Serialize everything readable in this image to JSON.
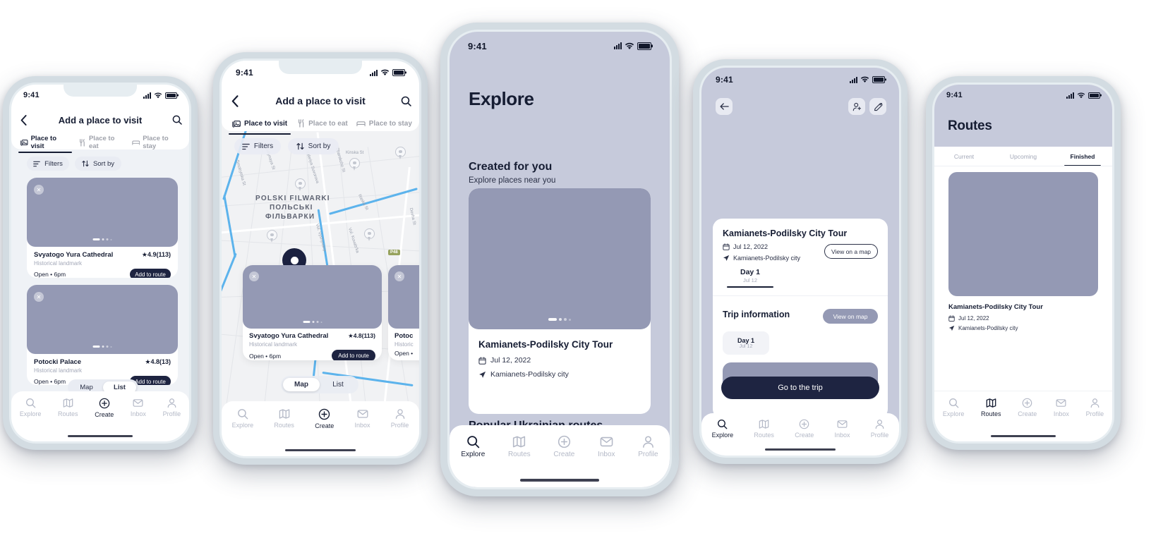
{
  "meta": {
    "status_time": "9:41",
    "colors": {
      "dark": "#1e2441",
      "lavender": "#c6cadb",
      "thumb": "#9499b4",
      "muted": "#a3a8b8",
      "phone_frame": "#d3dce2"
    }
  },
  "screens": {
    "add_place_list": {
      "header_title": "Add a place to visit",
      "back_icon": "chevron-left-icon",
      "search_icon": "search-icon",
      "tabs": [
        {
          "label": "Place to visit",
          "icon": "photo-icon",
          "active": true
        },
        {
          "label": "Place to eat",
          "icon": "cutlery-icon",
          "active": false
        },
        {
          "label": "Place to stay",
          "icon": "bed-icon",
          "active": false
        }
      ],
      "controls": [
        {
          "label": "Filters",
          "icon": "filters-icon"
        },
        {
          "label": "Sort by",
          "icon": "sort-icon"
        }
      ],
      "places": [
        {
          "name": "Svyatogo Yura Cathedral",
          "category": "Historical landmark",
          "hours": "Open • 6pm",
          "rating": "4.9(113)",
          "action": "Add to route"
        },
        {
          "name": "Potocki Palace",
          "category": "Historical landmark",
          "hours": "Open • 6pm",
          "rating": "4.8(13)",
          "action": "Add to route"
        }
      ],
      "segment": {
        "options": [
          "Map",
          "List"
        ],
        "selected": "List"
      },
      "tabbar": [
        {
          "label": "Explore",
          "icon": "search-icon",
          "active": false
        },
        {
          "label": "Routes",
          "icon": "map-icon",
          "active": false
        },
        {
          "label": "Create",
          "icon": "plus-circle-icon",
          "active": true
        },
        {
          "label": "Inbox",
          "icon": "envelope-icon",
          "active": false
        },
        {
          "label": "Profile",
          "icon": "person-icon",
          "active": false
        }
      ]
    },
    "add_place_map": {
      "header_title": "Add a place to visit",
      "back_icon": "chevron-left-icon",
      "search_icon": "search-icon",
      "tabs": [
        {
          "label": "Place to visit",
          "icon": "photo-icon",
          "active": true
        },
        {
          "label": "Place to eat",
          "icon": "cutlery-icon",
          "active": false
        },
        {
          "label": "Place to stay",
          "icon": "bed-icon",
          "active": false
        }
      ],
      "controls": [
        {
          "label": "Filters",
          "icon": "filters-icon"
        },
        {
          "label": "Sort by",
          "icon": "sort-icon"
        }
      ],
      "map": {
        "district_latin": "POLSKI FILWARKI",
        "district_uk_line1": "ПОЛЬСЬКІ",
        "district_uk_line2": "ФІЛЬВАРКИ",
        "road_badge": "P48",
        "streets": [
          "Lidiynaya St",
          "Smotrytska St",
          "Valeriya Suvorova",
          "Zbarskoho St",
          "Raska St",
          "Dovha St",
          "Vul. Vyshyvany",
          "Vul. Kovals'ka",
          "Kinska St"
        ]
      },
      "cards": [
        {
          "name": "Svyatogo Yura Cathedral",
          "category": "Historical landmark",
          "hours": "Open • 6pm",
          "rating": "4.8(113)",
          "action": "Add to route"
        },
        {
          "name": "Potoc",
          "category": "Historic",
          "hours": "Open •",
          "rating": "",
          "action": ""
        }
      ],
      "segment": {
        "options": [
          "Map",
          "List"
        ],
        "selected": "Map"
      },
      "tabbar": [
        {
          "label": "Explore",
          "icon": "search-icon",
          "active": false
        },
        {
          "label": "Routes",
          "icon": "map-icon",
          "active": false
        },
        {
          "label": "Create",
          "icon": "plus-circle-icon",
          "active": true
        },
        {
          "label": "Inbox",
          "icon": "envelope-icon",
          "active": false
        },
        {
          "label": "Profile",
          "icon": "person-icon",
          "active": false
        }
      ]
    },
    "explore": {
      "page_title": "Explore",
      "section1": {
        "title": "Created for you",
        "subtitle": "Explore places near you",
        "card": {
          "name": "Kamianets-Podilsky City Tour",
          "date": "Jul 12, 2022",
          "date_icon": "calendar-icon",
          "location": "Kamianets-Podilsky city",
          "location_icon": "navigation-arrow-icon"
        }
      },
      "section2": {
        "title": "Popular Ukrainian routes"
      },
      "tabbar": [
        {
          "label": "Explore",
          "icon": "search-icon",
          "active": true
        },
        {
          "label": "Routes",
          "icon": "map-icon",
          "active": false
        },
        {
          "label": "Create",
          "icon": "plus-circle-icon",
          "active": false
        },
        {
          "label": "Inbox",
          "icon": "envelope-icon",
          "active": false
        },
        {
          "label": "Profile",
          "icon": "person-icon",
          "active": false
        }
      ]
    },
    "trip_detail": {
      "back_icon": "arrow-left-icon",
      "actions": [
        {
          "icon": "add-person-icon",
          "name": "invite"
        },
        {
          "icon": "edit-icon",
          "name": "edit"
        }
      ],
      "trip": {
        "name": "Kamianets-Podilsky City Tour",
        "date": "Jul 12, 2022",
        "date_icon": "calendar-icon",
        "location": "Kamianets-Podilsky city",
        "location_icon": "navigation-arrow-icon",
        "view_map_button": "View on a map",
        "day_tab": {
          "label": "Day 1",
          "sub": "Jul 12"
        }
      },
      "trip_information": {
        "title": "Trip information",
        "view_map_button": "View on map",
        "day_chip": {
          "label": "Day 1",
          "sub": "Jul 12"
        }
      },
      "primary_button": "Go to the trip",
      "tabbar": [
        {
          "label": "Explore",
          "icon": "search-icon",
          "active": true
        },
        {
          "label": "Routes",
          "icon": "map-icon",
          "active": false
        },
        {
          "label": "Create",
          "icon": "plus-circle-icon",
          "active": false
        },
        {
          "label": "Inbox",
          "icon": "envelope-icon",
          "active": false
        },
        {
          "label": "Profile",
          "icon": "person-icon",
          "active": false
        }
      ]
    },
    "routes": {
      "page_title": "Routes",
      "tabs": [
        {
          "label": "Current",
          "active": false
        },
        {
          "label": "Upcoming",
          "active": false
        },
        {
          "label": "Finished",
          "active": true
        }
      ],
      "item": {
        "name": "Kamianets-Podilsky City Tour",
        "date": "Jul 12, 2022",
        "date_icon": "calendar-icon",
        "location": "Kamianets-Podilsky city",
        "location_icon": "navigation-arrow-icon"
      },
      "tabbar": [
        {
          "label": "Explore",
          "icon": "search-icon",
          "active": false
        },
        {
          "label": "Routes",
          "icon": "map-icon",
          "active": true
        },
        {
          "label": "Create",
          "icon": "plus-circle-icon",
          "active": false
        },
        {
          "label": "Inbox",
          "icon": "envelope-icon",
          "active": false
        },
        {
          "label": "Profile",
          "icon": "person-icon",
          "active": false
        }
      ]
    }
  }
}
